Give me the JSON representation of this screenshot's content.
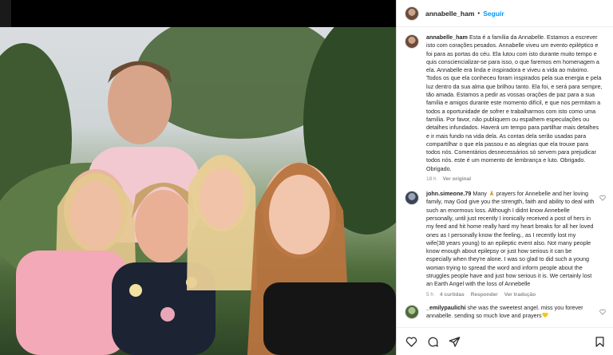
{
  "post": {
    "username": "annabelle_ham",
    "follow_label": "Seguir",
    "separator": "•",
    "photo_alt": ""
  },
  "caption": {
    "username": "annabelle_ham",
    "text": "Esta é a família da Annabelle. Estamos a escrever isto com corações pesados. Annabelle viveu um evento epiléptico e foi para as portas do céu. Ela lutou com isto durante muito tempo e quis consciencializar-se para isso, o que faremos em homenagem a ela. Annabelle era linda e inspiradora e viveu a vida ao máximo. Todos os que ela conheceu foram inspirados pela sua energia e pela luz dentro da sua alma que brilhou tanto. Ela foi, e será para sempre, tão amada. Estamos a pedir as vossas orações de paz para a sua família e amigos durante este momento difícil, e que nos permitam a todos a oportunidade de sofrer e trabalharmos com isto como uma família. Por favor, não publiquem ou espalhem especulações ou detalhes infundados. Haverá um tempo para partilhar mais detalhes e ir mais fundo na vida dela. As contas dela serão usadas para compartilhar o que ela passou e as alegrias que ela trouxe para todos nós. Comentários desnecessários só servem para prejudicar todos nós. este é um momento de lembrança e luto. Obrigado. Obrigado.",
    "time": "18 h",
    "see_original": "Ver original"
  },
  "comments": [
    {
      "username": "john.simeone.79",
      "text_before_emoji": "Many ",
      "emoji": "praying-hands",
      "text_after_emoji": " prayers for Annebelle and her loving family, may God give you the strength, faith and ability to deal with such an enormous loss. Although I didnt know Annebelle personally, until just recently I ironically received a post of hers in my feed and hit home really hard my heart breaks for all her loved ones as I personally know the feeling., as I recently lost my wife(38 years young) to an epileptic event also. Not many people know enough about epilepsy or just how serious it can be especially when they're alone. I was so glad to did such a young woman trying to spread the word and inform people about the struggles people have and just how serious it is. We certainly lost an Earth Angel with the loss of Annebelle",
      "time": "5 h",
      "likes": "4 curtidas",
      "reply": "Responder",
      "translate": "Ver tradução"
    },
    {
      "username": "_emilypaulichi",
      "text_before_emoji": "she was the sweetest angel. miss you forever annabelle. sending so much love and prayers",
      "emoji": "yellow-heart",
      "text_after_emoji": ""
    }
  ],
  "colors": {
    "follow": "#0095f6",
    "meta": "#8e8e8e",
    "text": "#262626"
  }
}
